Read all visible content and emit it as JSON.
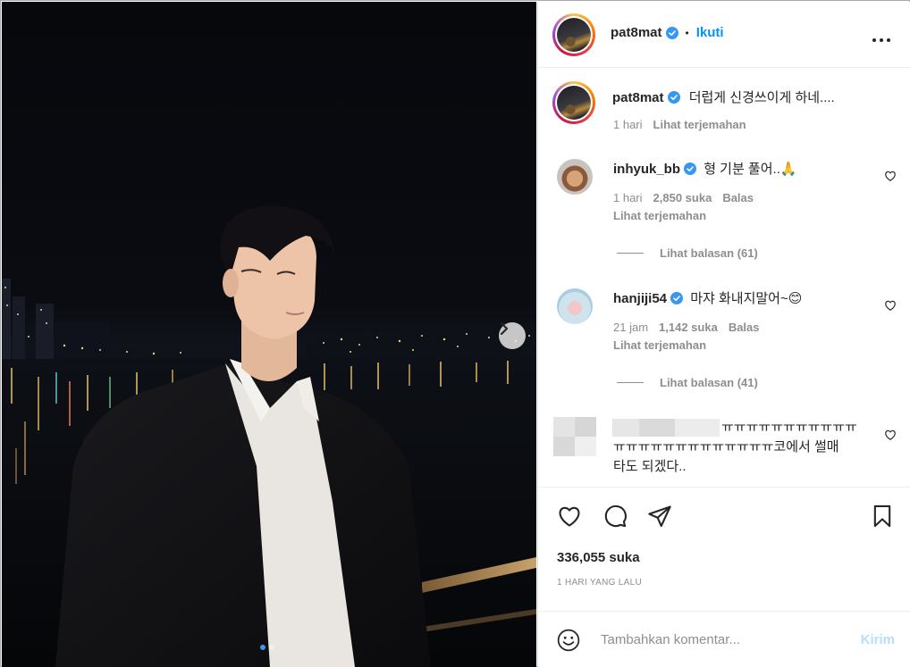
{
  "post": {
    "author": "pat8mat",
    "follow_label": "Ikuti",
    "separator": "•",
    "more_label": "•••",
    "caption": "더럽게 신경쓰이게 하네....",
    "caption_time": "1 hari",
    "translate_label": "Lihat terjemahan",
    "likes_count": "336,055 suka",
    "date_label": "1 HARI YANG LALU",
    "carousel": {
      "total": 2,
      "active": 1
    }
  },
  "comments": [
    {
      "username": "inhyuk_bb",
      "text": "형 기분 풀어..🙏",
      "time": "1 hari",
      "likes": "2,850 suka",
      "reply_label": "Balas",
      "translate_label": "Lihat terjemahan",
      "replies_label": "Lihat balasan (61)"
    },
    {
      "username": "hanjiji54",
      "text": "마쟈 화내지말어~😊",
      "time": "21 jam",
      "likes": "1,142 suka",
      "reply_label": "Balas",
      "translate_label": "Lihat terjemahan",
      "replies_label": "Lihat balasan (41)"
    },
    {
      "text_line1": "ㅠㅠㅠㅠㅠㅠㅠㅠㅠㅠㅠ",
      "text_line2": "ㅠㅠㅠㅠㅠㅠㅠㅠㅠㅠㅠㅠㅠ코에서 썰매",
      "text_line3": "타도 되겠다.."
    }
  ],
  "composer": {
    "placeholder": "Tambahkan komentar...",
    "send_label": "Kirim"
  },
  "icons": [
    "emoji-icon",
    "heart-icon",
    "comment-icon",
    "share-icon",
    "bookmark-icon",
    "verified-icon",
    "chevron-right-icon"
  ]
}
